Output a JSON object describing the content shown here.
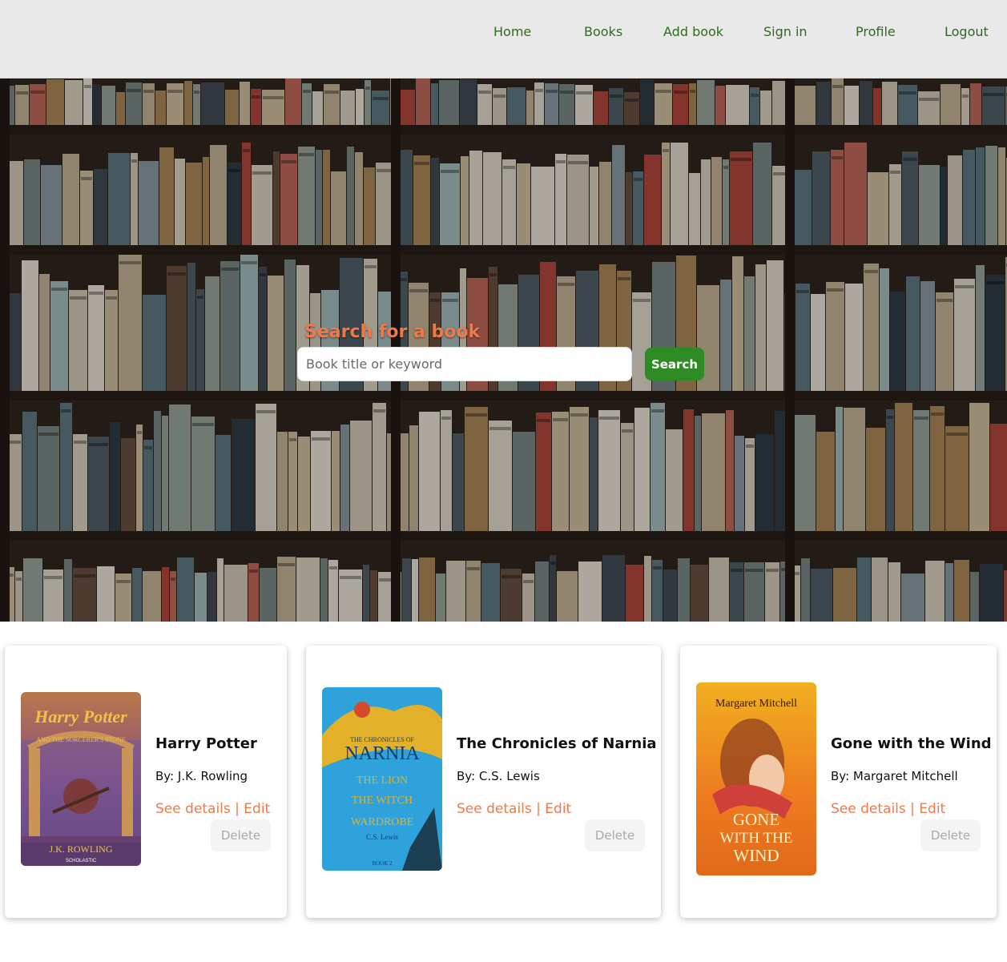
{
  "nav": {
    "home": "Home",
    "books": "Books",
    "add_book": "Add book",
    "sign_in": "Sign in",
    "profile": "Profile",
    "logout": "Logout"
  },
  "search": {
    "title": "Search for a book",
    "placeholder": "Book title or keyword",
    "button_label": "Search"
  },
  "books": [
    {
      "title": "Harry Potter",
      "author": "By: J.K. Rowling",
      "details_label": "See details",
      "separator": " | ",
      "edit_label": "Edit",
      "delete_label": "Delete",
      "cover": {
        "top_text": "Harry Potter",
        "sub_text": "AND THE SORCERER'S STONE",
        "bottom_text": "J.K. ROWLING",
        "publisher": "SCHOLASTIC"
      }
    },
    {
      "title": "The Chronicles of Narnia",
      "author": "By: C.S. Lewis",
      "details_label": "See details",
      "separator": " | ",
      "edit_label": "Edit",
      "delete_label": "Delete",
      "cover": {
        "top_text": "THE CHRONICLES OF",
        "main_text": "NARNIA",
        "sub_text": "THE LION, THE WITCH AND THE WARDROBE",
        "bottom_text": "C.S. Lewis",
        "book_label": "BOOK 2"
      }
    },
    {
      "title": "Gone with the Wind",
      "author": "By: Margaret Mitchell",
      "details_label": "See details",
      "separator": " | ",
      "edit_label": "Edit",
      "delete_label": "Delete",
      "cover": {
        "top_text": "Margaret Mitchell",
        "line1": "GONE",
        "line2": "WITH THE",
        "line3": "WIND"
      }
    }
  ],
  "colors": {
    "nav_bg": "#e9e9e9",
    "nav_link": "#2e6b1f",
    "accent": "#ee7a4a",
    "search_button": "#2e8b23",
    "delete_bg": "#f4f4f4",
    "delete_text": "#aaaaaa"
  }
}
